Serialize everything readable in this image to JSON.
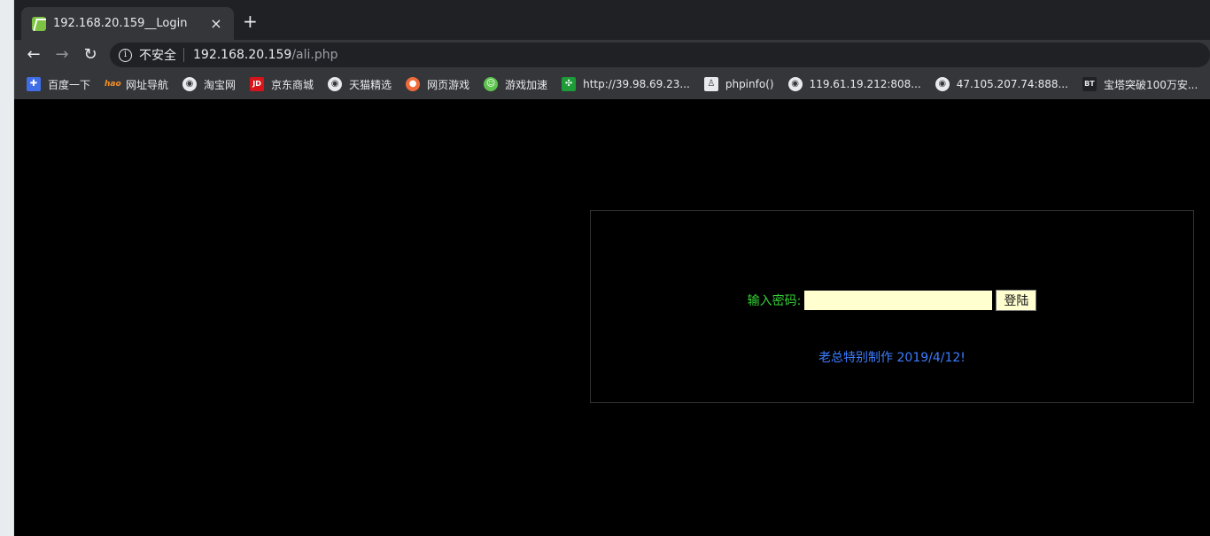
{
  "browser": {
    "tab": {
      "title": "192.168.20.159__Login",
      "close": "×",
      "new_tab": "+"
    },
    "toolbar": {
      "back": "←",
      "forward": "→",
      "reload": "↻",
      "security_icon": "i",
      "security_label": "不安全",
      "url_host": "192.168.20.159",
      "url_path": "/ali.php"
    },
    "bookmarks": [
      {
        "label": "百度一下",
        "icon": "paw-icon"
      },
      {
        "label": "网址导航",
        "icon": "hao-icon"
      },
      {
        "label": "淘宝网",
        "icon": "globe-icon"
      },
      {
        "label": "京东商城",
        "icon": "jd-icon"
      },
      {
        "label": "天猫精选",
        "icon": "globe-icon"
      },
      {
        "label": "网页游戏",
        "icon": "balloon-icon"
      },
      {
        "label": "游戏加速",
        "icon": "speed-icon"
      },
      {
        "label": "http://39.98.69.23...",
        "icon": "leaf-icon"
      },
      {
        "label": "phpinfo()",
        "icon": "person-icon"
      },
      {
        "label": "119.61.19.212:808...",
        "icon": "globe-icon"
      },
      {
        "label": "47.105.207.74:888...",
        "icon": "globe-icon"
      },
      {
        "label": "宝塔突破100万安...",
        "icon": "bt-icon"
      }
    ]
  },
  "page": {
    "login_label": "输入密码:",
    "password_value": "",
    "login_button": "登陆",
    "credit": "老总特别制作 2019/4/12!"
  },
  "colors": {
    "background": "#000000",
    "label_green": "#34d134",
    "credit_blue": "#3d7dff",
    "input_background": "#ffffd0"
  }
}
